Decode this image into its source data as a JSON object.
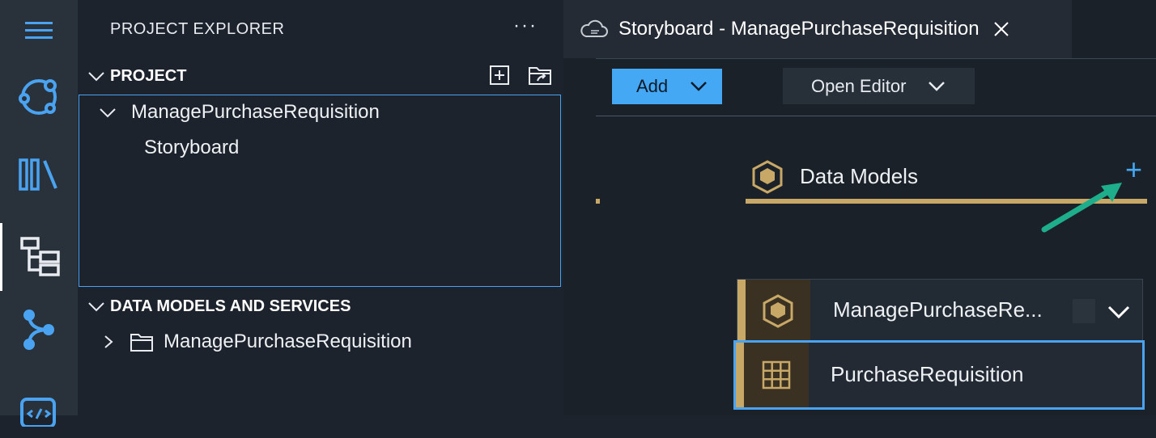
{
  "activity_bar": {
    "items": [
      {
        "name": "menu-icon"
      },
      {
        "name": "connection-icon"
      },
      {
        "name": "library-icon"
      },
      {
        "name": "explorer-tree-icon",
        "active": true
      },
      {
        "name": "source-control-icon"
      },
      {
        "name": "code-icon"
      }
    ]
  },
  "explorer": {
    "title": "PROJECT EXPLORER",
    "more_label": "···",
    "project_section": {
      "label": "PROJECT",
      "root": "ManagePurchaseRequisition",
      "child": "Storyboard"
    },
    "data_section": {
      "label": "DATA MODELS AND SERVICES",
      "folder": "ManagePurchaseRequisition"
    }
  },
  "editor": {
    "tab_title": "Storyboard - ManagePurchaseRequisition",
    "toolbar": {
      "add_label": "Add",
      "open_editor_label": "Open Editor"
    },
    "data_models": {
      "label": "Data Models",
      "add_symbol": "+",
      "service": "ManagePurchaseRe...",
      "entity": "PurchaseRequisition"
    }
  },
  "colors": {
    "accent_blue": "#45a8f5",
    "gold": "#c7a867",
    "annotation_arrow": "#1fae8c"
  }
}
